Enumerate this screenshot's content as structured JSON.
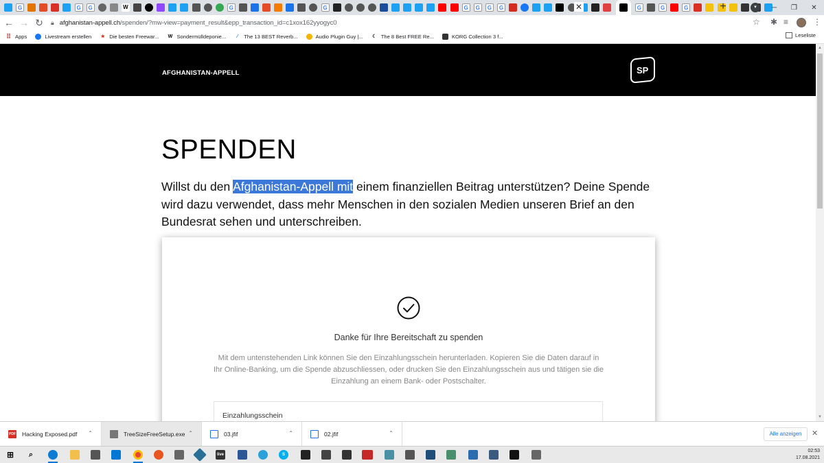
{
  "browser": {
    "url_domain": "afghanistan-appell.ch",
    "url_path": "/spenden/?mw-view=payment_result&epp_transaction_id=c1xox162yyogyc0",
    "bookmarks": [
      {
        "label": "Apps",
        "color": "#5f6368",
        "icon": "apps-grid-icon"
      },
      {
        "label": "Livestream erstellen",
        "color": "#1877f2",
        "icon": "facebook-icon"
      },
      {
        "label": "Die besten Freewar...",
        "color": "#d93025",
        "icon": "star-icon"
      },
      {
        "label": "Sondermülldeponie...",
        "color": "#000000",
        "icon": "w-icon"
      },
      {
        "label": "The 13 BEST Reverb...",
        "color": "#1a73e8",
        "icon": "wave-icon"
      },
      {
        "label": "Audio Plugin Guy |...",
        "color": "#f4b400",
        "icon": "plugin-icon"
      },
      {
        "label": "The 8 Best FREE Re...",
        "color": "#222222",
        "icon": "moon-icon"
      },
      {
        "label": "KORG Collection 3 f...",
        "color": "#333333",
        "icon": "korg-icon"
      }
    ],
    "reading_list": "Leseliste"
  },
  "site": {
    "brand": "AFGHANISTAN-APPELL",
    "logo_text": "SP"
  },
  "page": {
    "heading": "SPENDEN",
    "intro_before": "Willst du den ",
    "intro_highlight": "Afghanistan-Appell mit",
    "intro_after": " einem finanziellen Beitrag unterstützen? Deine Spende wird dazu verwendet, dass mehr Menschen in den sozialen Medien unseren Brief an den Bundesrat sehen und unterschreiben."
  },
  "card": {
    "thanks": "Danke für Ihre Bereitschaft zu spenden",
    "description": "Mit dem untenstehenden Link können Sie den Einzahlungsschein herunterladen. Kopieren Sie die Daten darauf in Ihr Online-Banking, um die Spende abzuschliessen, oder drucken Sie den Einzahlungsschein aus und tätigen sie die Einzahlung an einem Bank- oder Postschalter.",
    "slip_label": "Einzahlungsschein"
  },
  "downloads": {
    "items": [
      {
        "name": "Hacking Exposed.pdf",
        "icon": "pdf-icon",
        "color": "#d93025"
      },
      {
        "name": "TreeSizeFreeSetup.exe",
        "icon": "installer-icon",
        "color": "#5f6368"
      },
      {
        "name": "03.jfif",
        "icon": "image-file-icon",
        "color": "#1a73e8"
      },
      {
        "name": "02.jfif",
        "icon": "image-file-icon",
        "color": "#1a73e8"
      }
    ],
    "show_all": "Alle anzeigen"
  },
  "taskbar": {
    "time": "02:53",
    "date": "17.08.2021"
  },
  "colors": {
    "header_bg": "#000000",
    "highlight": "#3c78d8",
    "link_blue": "#1a73e8"
  }
}
